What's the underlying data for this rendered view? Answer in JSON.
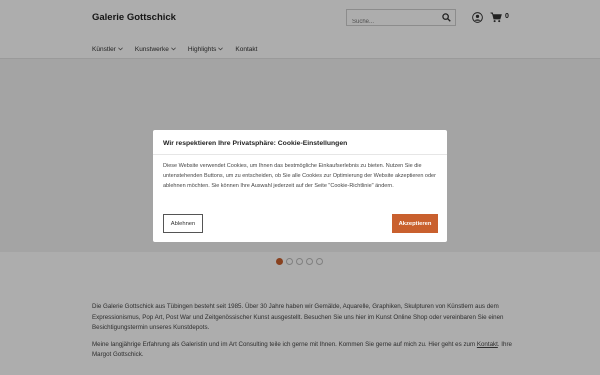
{
  "header": {
    "logo": "Galerie Gottschick",
    "search_placeholder": "Suche...",
    "cart_count": "0"
  },
  "nav": [
    {
      "label": "Künstler"
    },
    {
      "label": "Kunstwerke"
    },
    {
      "label": "Highlights"
    },
    {
      "label": "Kontakt"
    }
  ],
  "slider": {
    "slide_count": 5,
    "active_index": 0
  },
  "about": {
    "paragraph1": "Die Galerie Gottschick aus Tübingen besteht seit 1985. Über 30 Jahre haben wir Gemälde, Aquarelle, Graphiken, Skulpturen von Künstlern aus dem Expressionismus, Pop Art, Post War und Zeitgenössischer Kunst ausgestellt. Besuchen Sie uns hier im Kunst Online Shop oder vereinbaren Sie einen Besichtigungstermin unseres Kunstdepots.",
    "paragraph2_before": "Meine langjährige Erfahrung als Galeristin und im Art Consulting teile ich gerne mit Ihnen. Kommen Sie gerne auf mich zu. Hier geht es zum ",
    "paragraph2_link": "Kontakt",
    "paragraph2_after": ". Ihre Margot Gottschick."
  },
  "cookie_modal": {
    "title": "Wir respektieren Ihre Privatsphäre: Cookie-Einstellungen",
    "text": "Diese Website verwendet Cookies, um Ihnen das bestmögliche Einkaufserlebnis zu bieten. Nutzen Sie die untenstehenden Buttons, um zu entscheiden, ob Sie alle Cookies zur Optimierung der Website akzeptieren oder ablehnen möchten. Sie können Ihre Auswahl jederzeit auf der Seite \"Cookie-Richtlinie\" ändern.",
    "decline_label": "Ablehnen",
    "accept_label": "Akzeptieren"
  },
  "colors": {
    "accent": "#c9602e",
    "overlay": "rgba(0,0,0,0.32)"
  },
  "icons": {
    "search": "search-icon",
    "user": "user-icon",
    "cart": "cart-icon",
    "chevron": "chevron-down-icon"
  }
}
